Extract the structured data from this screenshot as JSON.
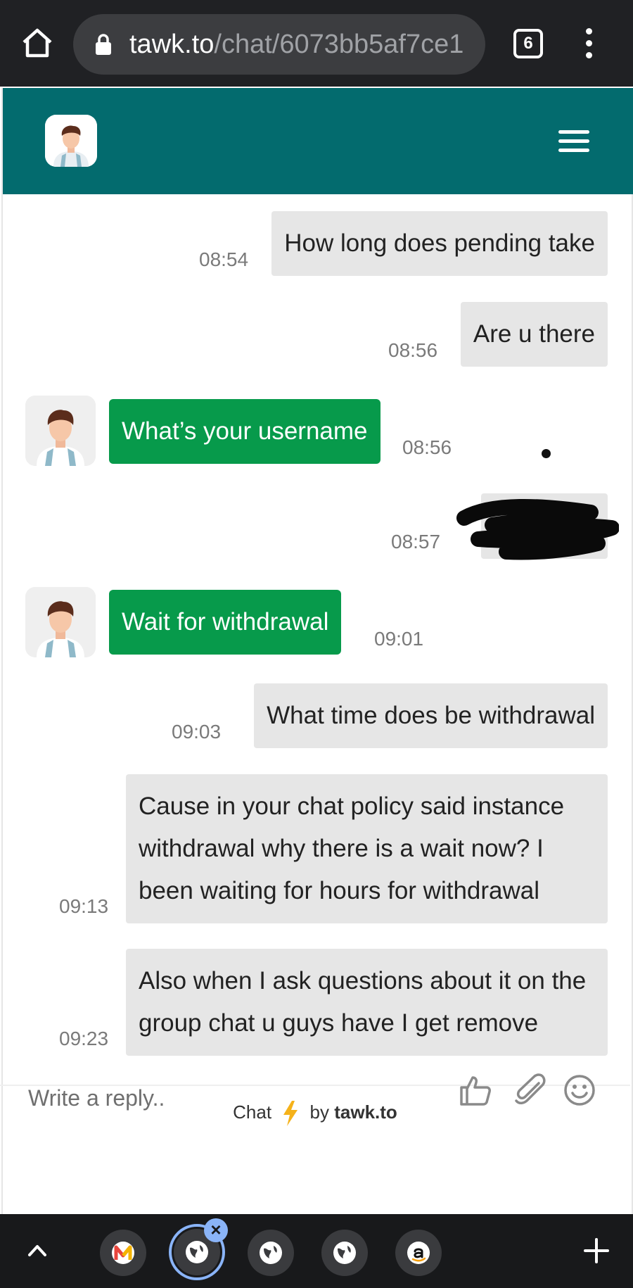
{
  "browser": {
    "url_host": "tawk.to",
    "url_path": "/chat/6073bb5af7ce1",
    "tab_count": "6"
  },
  "colors": {
    "header": "#036b6e",
    "agent_bubble": "#079a4b",
    "visitor_bubble": "#e6e6e6",
    "bolt": "#f5b21a",
    "tab_accent": "#8ab4f8"
  },
  "messages": [
    {
      "sender": "visitor",
      "text": "How long does pending take",
      "time": "08:54"
    },
    {
      "sender": "visitor",
      "text": "Are u there",
      "time": "08:56"
    },
    {
      "sender": "agent",
      "text": "What’s your username",
      "time": "08:56"
    },
    {
      "sender": "visitor",
      "text": "",
      "time": "08:57"
    },
    {
      "sender": "agent",
      "text": "Wait for withdrawal",
      "time": "09:01"
    },
    {
      "sender": "visitor",
      "text": "What time does be withdrawal",
      "time": "09:03"
    },
    {
      "sender": "visitor",
      "text": "Cause in your chat policy said instance withdrawal why there is a wait now? I been waiting for hours for withdrawal",
      "time": "09:13"
    },
    {
      "sender": "visitor",
      "text": "Also when I ask questions about it on the group chat u guys have I get remove",
      "time": "09:23"
    }
  ],
  "footer": {
    "powered_prefix": "Chat",
    "powered_by": "by",
    "powered_brand": "tawk.to",
    "reply_placeholder": "Write a reply.."
  },
  "icons": {
    "toolbar": [
      "thumbs-up-icon",
      "paperclip-icon",
      "emoji-icon"
    ],
    "bottom_tabs": [
      "m-app-icon",
      "globe-icon",
      "globe-icon",
      "globe-icon",
      "amazon-icon"
    ]
  }
}
